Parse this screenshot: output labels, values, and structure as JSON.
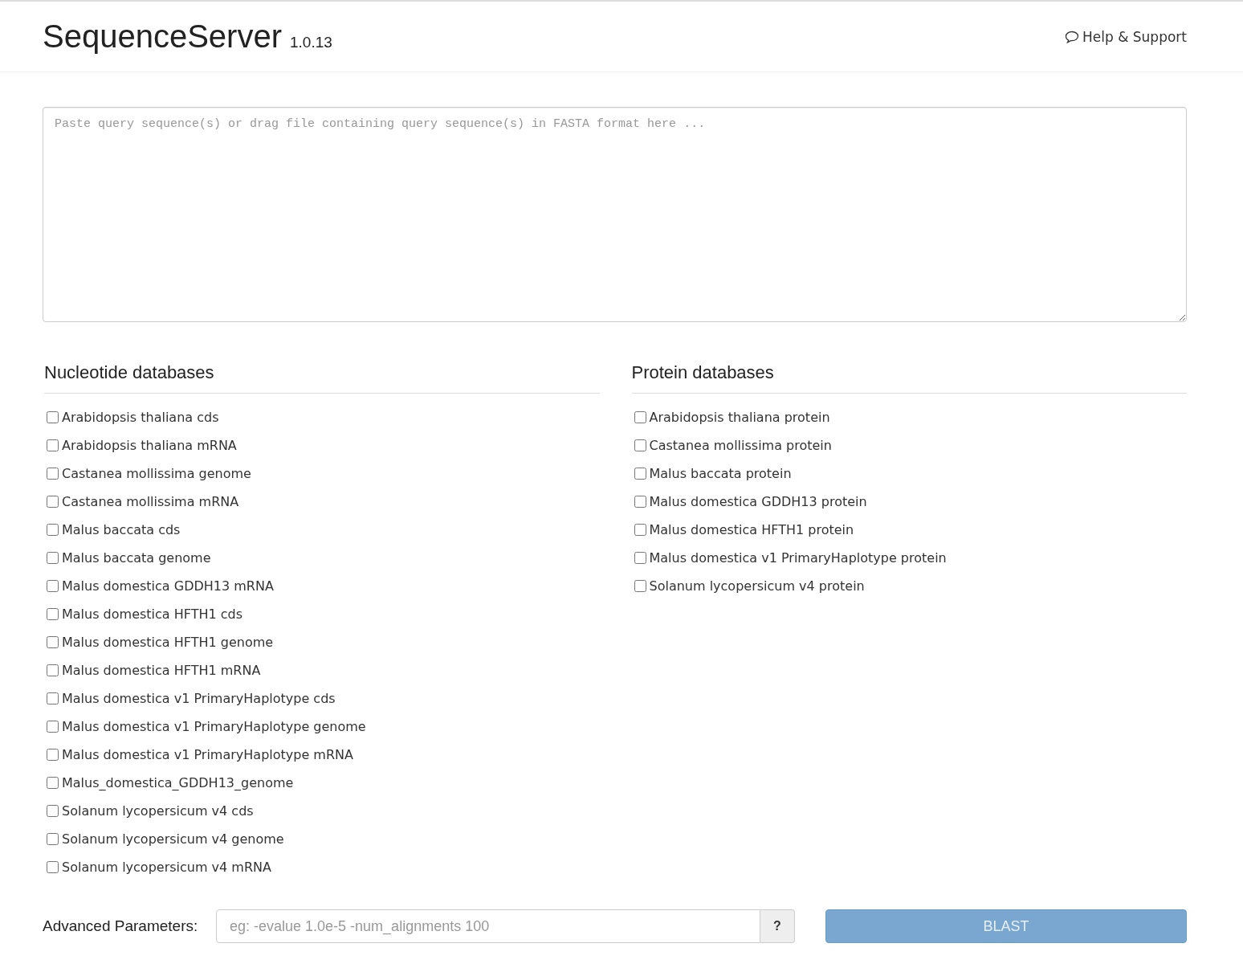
{
  "header": {
    "title": "SequenceServer",
    "version": "1.0.13",
    "help_link": "Help & Support"
  },
  "query": {
    "placeholder": "Paste query sequence(s) or drag file containing query sequence(s) in FASTA format here ..."
  },
  "databases": [
    {
      "heading": "Nucleotide databases",
      "items": [
        {
          "label": "Arabidopsis thaliana cds",
          "checked": false
        },
        {
          "label": "Arabidopsis thaliana mRNA",
          "checked": false
        },
        {
          "label": "Castanea mollissima genome",
          "checked": false
        },
        {
          "label": "Castanea mollissima mRNA",
          "checked": false
        },
        {
          "label": "Malus baccata cds",
          "checked": false
        },
        {
          "label": "Malus baccata genome",
          "checked": false
        },
        {
          "label": "Malus domestica GDDH13 mRNA",
          "checked": false
        },
        {
          "label": "Malus domestica HFTH1 cds",
          "checked": false
        },
        {
          "label": "Malus domestica HFTH1 genome",
          "checked": false
        },
        {
          "label": "Malus domestica HFTH1 mRNA",
          "checked": false
        },
        {
          "label": "Malus domestica v1 PrimaryHaplotype cds",
          "checked": false
        },
        {
          "label": "Malus domestica v1 PrimaryHaplotype genome",
          "checked": false
        },
        {
          "label": "Malus domestica v1 PrimaryHaplotype mRNA",
          "checked": false
        },
        {
          "label": "Malus_domestica_GDDH13_genome",
          "checked": false
        },
        {
          "label": "Solanum lycopersicum v4 cds",
          "checked": false
        },
        {
          "label": "Solanum lycopersicum v4 genome",
          "checked": false
        },
        {
          "label": "Solanum lycopersicum v4 mRNA",
          "checked": false
        }
      ]
    },
    {
      "heading": "Protein databases",
      "items": [
        {
          "label": "Arabidopsis thaliana protein",
          "checked": false
        },
        {
          "label": "Castanea mollissima protein",
          "checked": false
        },
        {
          "label": "Malus baccata protein",
          "checked": false
        },
        {
          "label": "Malus domestica GDDH13 protein",
          "checked": false
        },
        {
          "label": "Malus domestica HFTH1 protein",
          "checked": false
        },
        {
          "label": "Malus domestica v1 PrimaryHaplotype protein",
          "checked": false
        },
        {
          "label": "Solanum lycopersicum v4 protein",
          "checked": false
        }
      ]
    }
  ],
  "advanced": {
    "label": "Advanced Parameters:",
    "placeholder": "eg: -evalue 1.0e-5 -num_alignments 100",
    "help_button": "?"
  },
  "blast_button": {
    "label": "BLAST",
    "disabled": true
  }
}
